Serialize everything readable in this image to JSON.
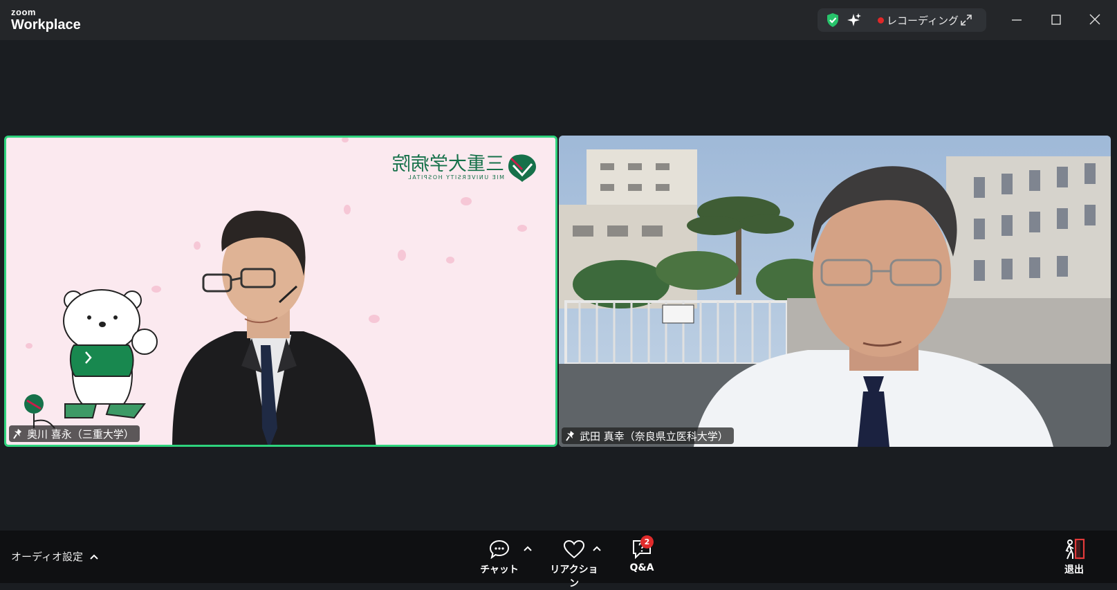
{
  "app": {
    "brand_small": "zoom",
    "brand_large": "Workplace"
  },
  "status": {
    "recording_label": "レコーディング"
  },
  "colors": {
    "active_speaker": "#2ed37d",
    "recording": "#e02828",
    "badge": "#e02b2b"
  },
  "participants": [
    {
      "name": "奥川 喜永（三重大学）",
      "logo_text": "三重大学病院",
      "logo_sub": "MIE UNIVERSITY HOSPITAL"
    },
    {
      "name": "武田 真幸（奈良県立医科大学）"
    }
  ],
  "toolbar": {
    "audio_label": "オーディオ設定",
    "chat_label": "チャット",
    "reaction_label": "リアクション",
    "qa_label": "Q&A",
    "qa_badge": "2",
    "leave_label": "退出"
  }
}
